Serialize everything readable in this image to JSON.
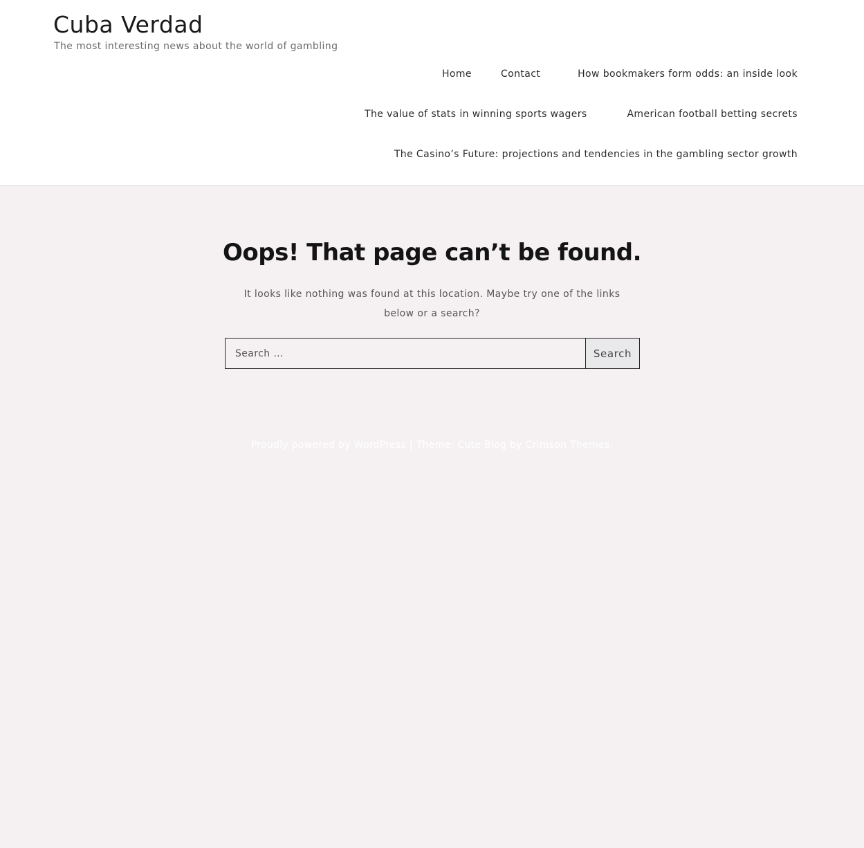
{
  "site": {
    "title": "Cuba Verdad",
    "tagline": "The most interesting news about the world of gambling"
  },
  "nav": {
    "items": [
      {
        "label": "Home"
      },
      {
        "label": "Contact"
      },
      {
        "label": "How bookmakers form odds: an inside look"
      },
      {
        "label": "The value of stats in winning sports wagers"
      },
      {
        "label": "American football betting secrets"
      },
      {
        "label": "The Casino’s Future: projections and tendencies in the gambling sector growth"
      }
    ]
  },
  "main": {
    "title": "Oops! That page can’t be found.",
    "message": "It looks like nothing was found at this location. Maybe try one of the links below or a search?",
    "search": {
      "placeholder": "Search …",
      "value": "",
      "button_label": "Search"
    }
  },
  "footer": {
    "powered_text": "Proudly powered by WordPress",
    "separator": " | ",
    "theme_text": "Theme: Cute Blog by",
    "author_link": "Crimson Themes",
    "period": "."
  },
  "colors": {
    "page_background": "#f5f1f2",
    "header_background": "#ffffff",
    "heading": "#141414",
    "body_text": "#555555",
    "footer_text": "#ffffff",
    "button_background": "#e9e9ec"
  }
}
